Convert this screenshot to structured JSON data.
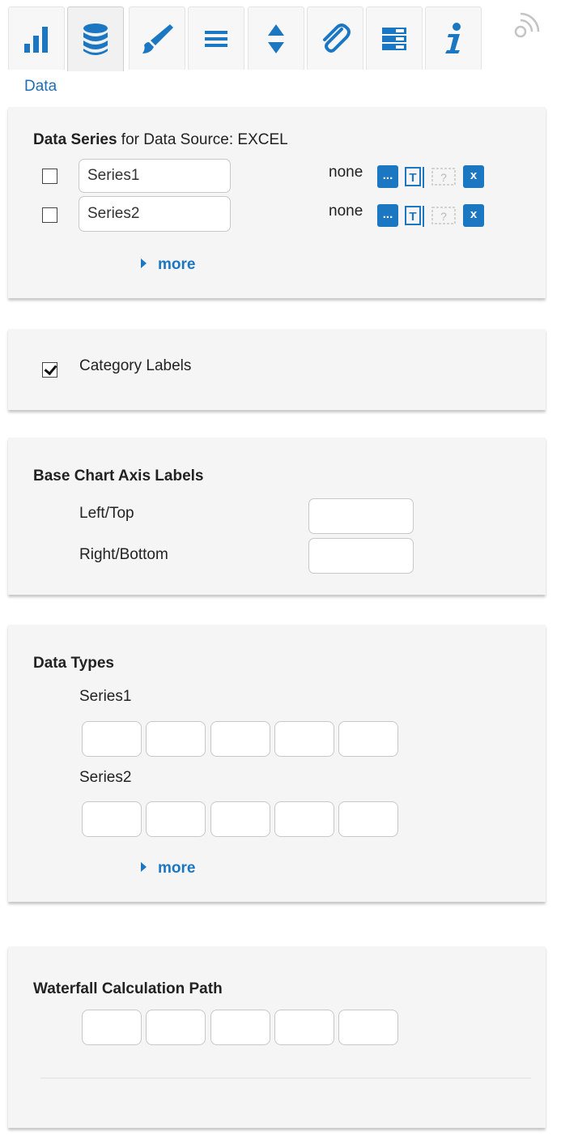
{
  "toolbar": {
    "tabs": [
      {
        "name": "bar-chart-icon",
        "active": false
      },
      {
        "name": "database-icon",
        "active": true
      },
      {
        "name": "brush-icon",
        "active": false
      },
      {
        "name": "list-icon",
        "active": false
      },
      {
        "name": "sort-icon",
        "active": false
      },
      {
        "name": "paperclip-icon",
        "active": false
      },
      {
        "name": "table-icon",
        "active": false
      },
      {
        "name": "info-icon",
        "active": false
      }
    ],
    "extra_icon": "rss-icon"
  },
  "section_label": "Data",
  "colors": {
    "accent": "#1c77c3",
    "panel": "#f5f5f5"
  },
  "data_series": {
    "title_bold": "Data Series",
    "title_rest": " for Data Source: EXCEL",
    "rows": [
      {
        "checked": false,
        "value": "Series1",
        "status": "none",
        "dots_label": "...",
        "remove_label": "x"
      },
      {
        "checked": false,
        "value": "Series2",
        "status": "none",
        "dots_label": "...",
        "remove_label": "x"
      }
    ],
    "more_label": "more"
  },
  "category_labels": {
    "checked": true,
    "label": "Category Labels"
  },
  "axis_labels": {
    "title": "Base Chart Axis Labels",
    "left_top_label": "Left/Top",
    "left_top_value": "",
    "right_bottom_label": "Right/Bottom",
    "right_bottom_value": ""
  },
  "data_types": {
    "title": "Data Types",
    "series1_label": "Series1",
    "series2_label": "Series2",
    "more_label": "more"
  },
  "waterfall": {
    "title": "Waterfall Calculation Path"
  }
}
